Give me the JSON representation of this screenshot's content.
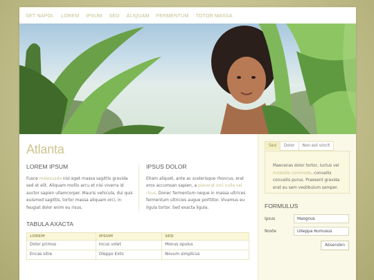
{
  "nav": [
    "SET NAPOL",
    "LOREM",
    "IPSUM",
    "SED",
    "ALIQUAM",
    "FERMENTUM",
    "TOTOR MASSA"
  ],
  "page_title": "Atlanta",
  "col1": {
    "heading": "LOREM IPSUM",
    "text_pre": "Fusce ",
    "link": "malesuada",
    "text_post": " nisi eget massa sagittis gravida sed at elit. Aliquam mollis arcu et nisi viverra id auctor sapien ullamcorper. Mauris vehicula, dui quis euismod sagittis, tortor massa aliquam orci, in feugiat dolor enim eu risus."
  },
  "col2": {
    "heading": "IPSUS DOLOR",
    "text_pre": "Etiam aliquet, ante ac scelerisque rhoncus, erat eros accumsan sapien, a ",
    "link": "placerat orci nulla vel risus",
    "text_post": ". Donec fermentum neque in massa ultrices fermentum ultricies augue porttitor. Vivamus eu ligula tortor. Sed exacta ligula."
  },
  "table": {
    "title": "TABULA AXACTA",
    "headers": [
      "LOREM",
      "IPSUM",
      "SED"
    ],
    "rows": [
      [
        "Dolor primus",
        "Incus volet",
        "Monus opulus"
      ],
      [
        "Encas sitre",
        "Oleppo Exto",
        "Novum simplicus"
      ]
    ]
  },
  "tabs": [
    "Sed",
    "Dolor",
    "Non est vincit"
  ],
  "tab_panel": {
    "text_pre": "Maecenas dolor tortor, luctus vel ",
    "link": "molestie commodo",
    "text_post": ", convallis convallis purus. Praesent gravida erat eu sem vestibulum semper."
  },
  "form": {
    "heading": "FORMULUS",
    "fields": [
      {
        "label": "Ipsus",
        "value": "Malignus"
      },
      {
        "label": "Noxte",
        "value": "Olleppa Rumusus"
      }
    ],
    "submit": "Absenden"
  },
  "colors": {
    "accent": "#c3c08a",
    "background": "#c4c08e",
    "sidebar": "#faf9e7"
  }
}
